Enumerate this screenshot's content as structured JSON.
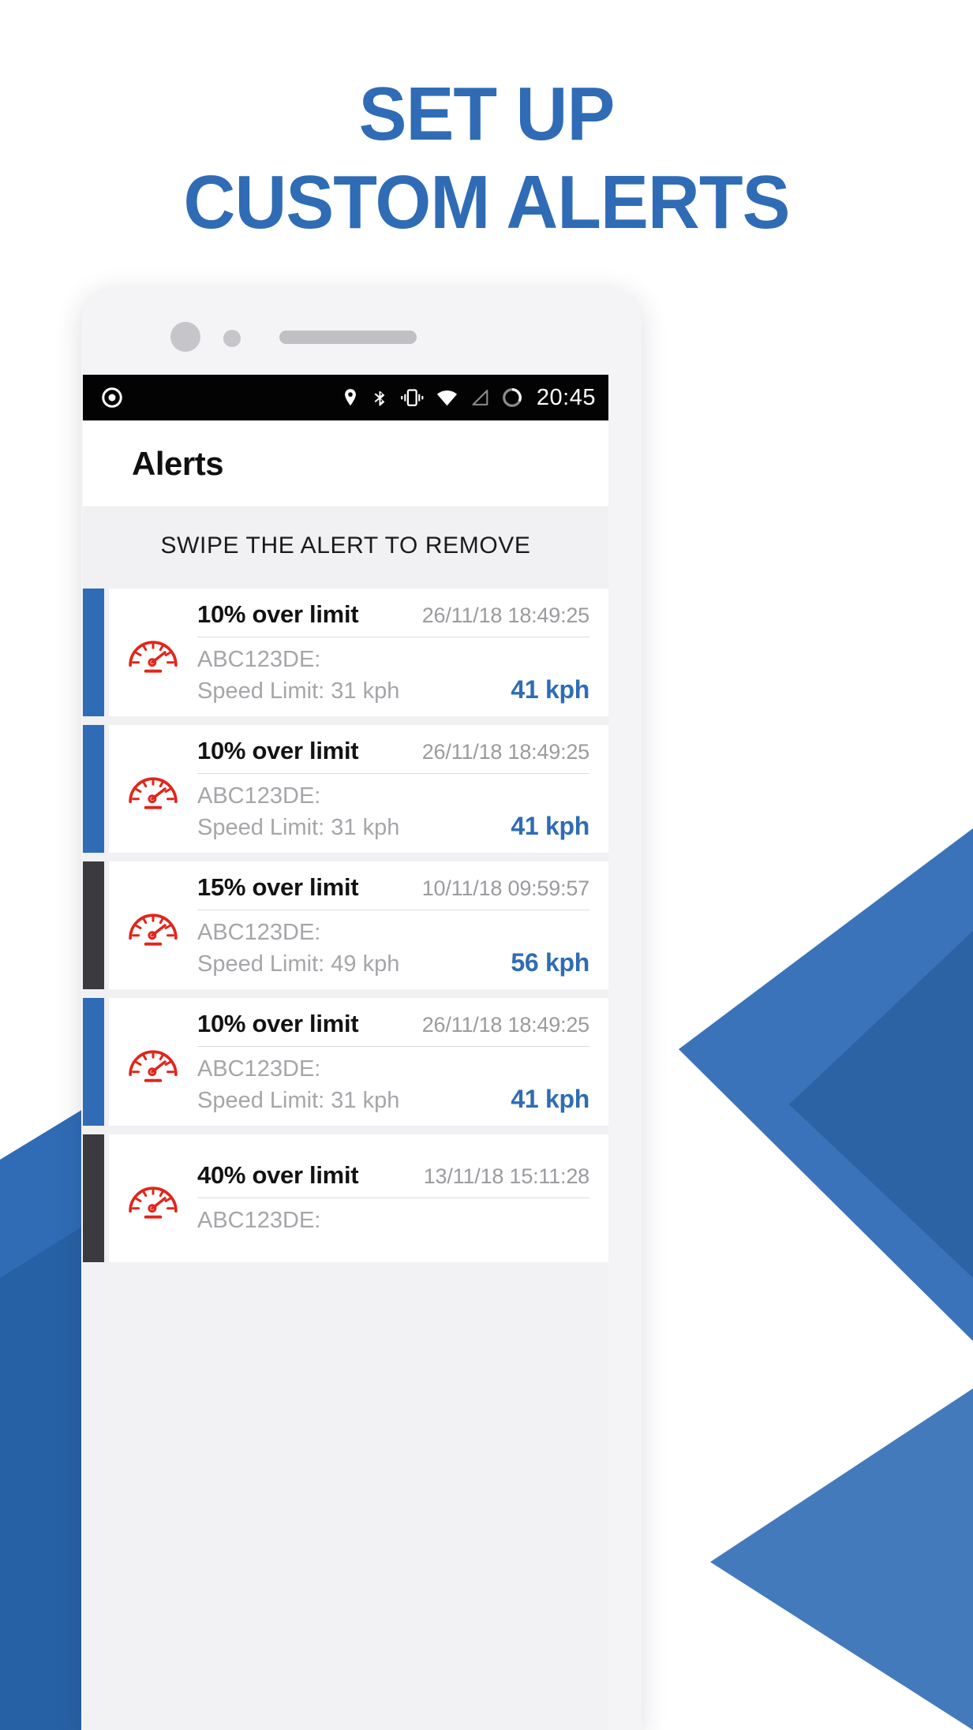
{
  "headline": {
    "line1": "SET UP",
    "line2": "CUSTOM ALERTS",
    "color": "#2f6cb5"
  },
  "status_bar": {
    "time": "20:45",
    "icons_left": [
      "record-dot-icon"
    ],
    "icons_right": [
      "location-pin-icon",
      "bluetooth-icon",
      "vibrate-icon",
      "wifi-icon",
      "cell-signal-icon",
      "battery-circle-icon"
    ]
  },
  "app_bar": {
    "title": "Alerts"
  },
  "banner": {
    "text": "SWIPE THE ALERT TO REMOVE"
  },
  "colors": {
    "accent_blue": "#2f6cb5",
    "accent_dark": "#3b3b3f",
    "icon_red": "#e1251b",
    "muted_text": "#a6a6aa"
  },
  "alerts": [
    {
      "accent": "blue",
      "icon": "speedometer-icon",
      "title": "10% over limit",
      "timestamp": "26/11/18 18:49:25",
      "plate": "ABC123DE:",
      "speed_limit": "Speed Limit: 31 kph",
      "speed": "41 kph"
    },
    {
      "accent": "blue",
      "icon": "speedometer-icon",
      "title": "10% over limit",
      "timestamp": "26/11/18 18:49:25",
      "plate": "ABC123DE:",
      "speed_limit": "Speed Limit: 31 kph",
      "speed": "41 kph"
    },
    {
      "accent": "dark",
      "icon": "speedometer-icon",
      "title": "15% over limit",
      "timestamp": "10/11/18 09:59:57",
      "plate": "ABC123DE:",
      "speed_limit": "Speed Limit: 49 kph",
      "speed": "56 kph"
    },
    {
      "accent": "blue",
      "icon": "speedometer-icon",
      "title": "10% over limit",
      "timestamp": "26/11/18 18:49:25",
      "plate": "ABC123DE:",
      "speed_limit": "Speed Limit: 31 kph",
      "speed": "41 kph"
    },
    {
      "accent": "dark",
      "icon": "speedometer-icon",
      "title": "40% over limit",
      "timestamp": "13/11/18 15:11:28",
      "plate": "ABC123DE:",
      "speed_limit": "",
      "speed": ""
    }
  ]
}
